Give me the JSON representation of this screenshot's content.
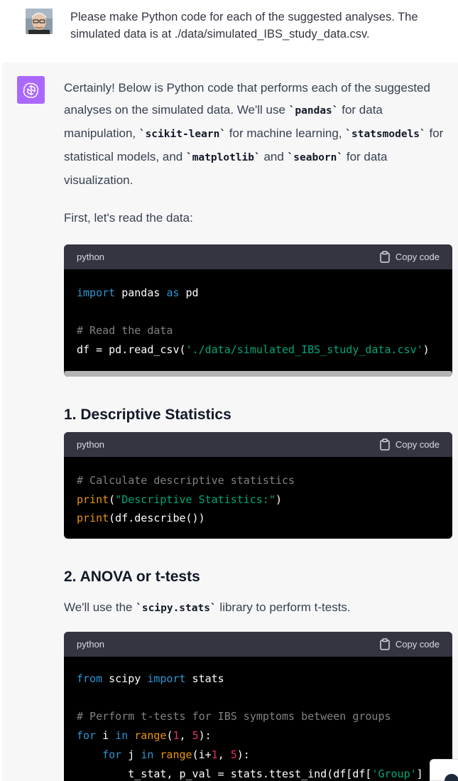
{
  "user_message": {
    "text": "Please make Python code for each of the suggested analyses. The simulated data is at ./data/simulated_IBS_study_data.csv."
  },
  "assistant": {
    "intro": {
      "t1": "Certainly! Below is Python code that performs each of the suggested analyses on the simulated data. We'll use ",
      "c1": "`pandas`",
      "t2": " for data manipulation, ",
      "c2": "`scikit-learn`",
      "t3": " for machine learning, ",
      "c3": "`statsmodels`",
      "t4": " for statistical models, and ",
      "c4": "`matplotlib`",
      "t5": " and ",
      "c5": "`seaborn`",
      "t6": " for data visualization."
    },
    "read_intro": "First, let's read the data:",
    "heading1": "1. Descriptive Statistics",
    "heading2": "2. ANOVA or t-tests",
    "ttest_intro": {
      "t1": "We'll use the ",
      "c1": "`scipy.stats`",
      "t2": " library to perform t-tests."
    }
  },
  "code_header": {
    "lang": "python",
    "copy_label": "Copy code"
  },
  "code_blocks": {
    "read": {
      "l1": {
        "kw1": "import",
        "t1": " pandas ",
        "kw2": "as",
        "t2": " pd"
      },
      "l3": "# Read the data",
      "l4": {
        "t1": "df = pd.read_csv(",
        "s1": "'./data/simulated_IBS_study_data.csv'",
        "t2": ")"
      }
    },
    "describe": {
      "l1": "# Calculate descriptive statistics",
      "l2": {
        "b1": "print",
        "t1": "(",
        "s1": "\"Descriptive Statistics:\"",
        "t2": ")"
      },
      "l3": {
        "b1": "print",
        "t1": "(df.describe())"
      }
    },
    "ttest": {
      "l1": {
        "kw1": "from",
        "t1": " scipy ",
        "kw2": "import",
        "t2": " stats"
      },
      "l3": "# Perform t-tests for IBS symptoms between groups",
      "l4": {
        "kw1": "for",
        "t1": " i ",
        "kw2": "in",
        "t2": " ",
        "b1": "range",
        "t3": "(",
        "n1": "1",
        "t4": ", ",
        "n2": "5",
        "t5": "):"
      },
      "l5": {
        "ind": "    ",
        "kw1": "for",
        "t1": " j ",
        "kw2": "in",
        "t2": " ",
        "b1": "range",
        "t3": "(i+",
        "n1": "1",
        "t4": ", ",
        "n2": "5",
        "t5": "):"
      },
      "l6": {
        "ind": "        ",
        "t1": "t_stat, p_val = stats.ttest_ind(df[df[",
        "s1": "'Group'",
        "t2": "] ="
      }
    }
  },
  "colors": {
    "assistant_avatar": "#ab68ff",
    "code_bg": "#000000",
    "code_header_bg": "#343541",
    "keyword": "#2e95d3",
    "string": "#00a67d",
    "builtin": "#e9950c",
    "number": "#df3079"
  },
  "icons": {
    "assistant_avatar": "openai-logo-icon",
    "copy": "clipboard-icon"
  }
}
